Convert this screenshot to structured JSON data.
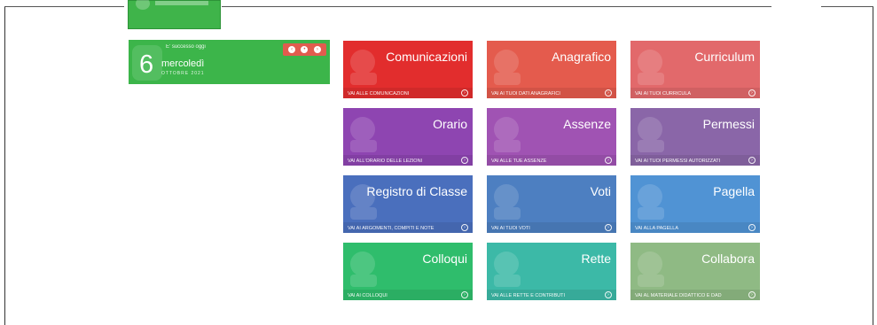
{
  "date_widget": {
    "caption": "E' successo oggi",
    "day": "6",
    "weekday": "mercoledì",
    "month_year": "OTTOBRE 2021",
    "nav": {
      "prev": "‹",
      "home": "•",
      "next": "›"
    }
  },
  "tiles": [
    {
      "title": "Comunicazioni",
      "link": "VAI ALLE COMUNICAZIONI",
      "color": "#e22d2d",
      "icon": "megaphone-icon"
    },
    {
      "title": "Anagrafico",
      "link": "VAI AI TUOI DATI ANAGRAFICI",
      "color": "#e45b4d",
      "icon": "user-icon"
    },
    {
      "title": "Curriculum",
      "link": "VAI AI TUOI CURRICULA",
      "color": "#e2696b",
      "icon": "list-icon"
    },
    {
      "title": "Orario",
      "link": "VAI ALL'ORARIO DELLE LEZIONI",
      "color": "#8e45b1",
      "icon": "clock-icon"
    },
    {
      "title": "Assenze",
      "link": "VAI ALLE TUE ASSENZE",
      "color": "#a053b3",
      "icon": "absence-icon"
    },
    {
      "title": "Permessi",
      "link": "VAI AI TUOI PERMESSI AUTORIZZATI",
      "color": "#8a66a8",
      "icon": "permit-icon"
    },
    {
      "title": "Registro di Classe",
      "link": "VAI AI ARGOMENTI, COMPITI E NOTE",
      "color": "#4a6fbd",
      "icon": "register-icon"
    },
    {
      "title": "Voti",
      "link": "VAI AI TUOI VOTI",
      "color": "#4d7fc1",
      "icon": "grade-icon"
    },
    {
      "title": "Pagella",
      "link": "VAI ALLA PAGELLA",
      "color": "#5093d4",
      "icon": "document-icon"
    },
    {
      "title": "Colloqui",
      "link": "VAI AI COLLOQUI",
      "color": "#2fbd6c",
      "icon": "chat-icon"
    },
    {
      "title": "Rette",
      "link": "VAI ALLE RETTE E CONTRIBUTI",
      "color": "#3cb9a7",
      "icon": "coins-icon"
    },
    {
      "title": "Collabora",
      "link": "VAI AL MATERIALE DIDATTICO E DAD",
      "color": "#8fba84",
      "icon": "puzzle-icon"
    }
  ]
}
